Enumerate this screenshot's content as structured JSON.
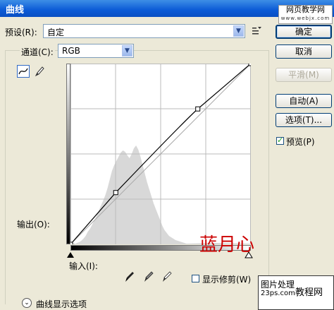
{
  "window": {
    "title": "曲线"
  },
  "watermark_top": {
    "line1": "网页教学网",
    "line2": "www.webjx.com"
  },
  "preset": {
    "label": "预设(R):",
    "value": "自定",
    "menu_icon": "list-menu-icon"
  },
  "channel": {
    "label": "通道(C):",
    "value": "RGB"
  },
  "buttons": {
    "ok": "确定",
    "cancel": "取消",
    "smooth": "平滑(M)",
    "auto": "自动(A)",
    "options": "选项(T)..."
  },
  "preview": {
    "label": "预览(P)",
    "checked": true
  },
  "output_label": "输出(O):",
  "input_label": "输入(I):",
  "show_clipping": {
    "label": "显示修剪(W)",
    "checked": false
  },
  "curve_options": {
    "label": "曲线显示选项"
  },
  "signature": "蓝月心",
  "watermark_bottom": {
    "line1": "图片处理",
    "line2": "23ps.com",
    "line3": "教程网"
  },
  "colors": {
    "curve": "#000000",
    "histogram": "#d8d8d8",
    "signature": "#cc0000",
    "title_bar": "#0b5ad6"
  },
  "curve": {
    "points": [
      [
        0,
        0
      ],
      [
        64,
        73
      ],
      [
        255,
        255
      ]
    ],
    "sample_point": [
      180,
      191
    ]
  }
}
